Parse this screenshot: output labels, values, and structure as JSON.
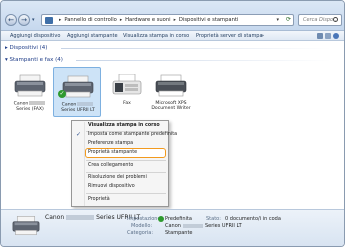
{
  "address": {
    "breadcrumb": [
      "Pannello di controllo",
      "Hardware e suoni",
      "Dispositivi e stampanti"
    ],
    "search_placeholder": "Cerca Dispo..."
  },
  "commandbar": {
    "add_device": "Aggiungi dispositivo",
    "add_printer": "Aggiungi stampante",
    "view_print": "Visualizza stampa in corso",
    "server_props": "Proprietà server di stampa",
    "more": "»"
  },
  "groups": {
    "devices": "Dispositivi (4)",
    "printers": "Stampanti e fax (4)"
  },
  "printers": [
    {
      "label_1": "Canon",
      "label_2": "Series (FAX)"
    },
    {
      "label_1": "Canon",
      "label_2": "Series UFRII LT"
    },
    {
      "label_1": "Fax",
      "label_2": ""
    },
    {
      "label_1": "Microsoft XPS",
      "label_2": "Document Writer"
    }
  ],
  "context_menu": {
    "items": [
      "Visualizza stampa in corso",
      "Imposta come stampante predefinita",
      "Preferenze stampa",
      "Proprietà stampante",
      "Crea collegamento",
      "Risoluzione dei problemi",
      "Rimuovi dispositivo",
      "Proprietà"
    ]
  },
  "details": {
    "name_prefix": "Canon",
    "name_suffix": "Series UFRII LT",
    "state_key": "Impostazione:",
    "state_value": "Predefinita",
    "status_key": "Stato:",
    "status_value": "0 documento/i in coda",
    "model_key": "Modello:",
    "model_value": "Canon",
    "model_suffix": "Series UFRII LT",
    "category_key": "Categoria:",
    "category_value": "Stampante"
  },
  "colors": {
    "highlight_border": "#f29a1e",
    "header_text": "#1e3c87",
    "selected_tile": "#cde3f7",
    "default_check": "#2f9a2f"
  },
  "icons": [
    "back-arrow-icon",
    "forward-arrow-icon",
    "folder-icon",
    "search-icon",
    "printer-icon",
    "fax-icon",
    "checkmark-icon"
  ]
}
